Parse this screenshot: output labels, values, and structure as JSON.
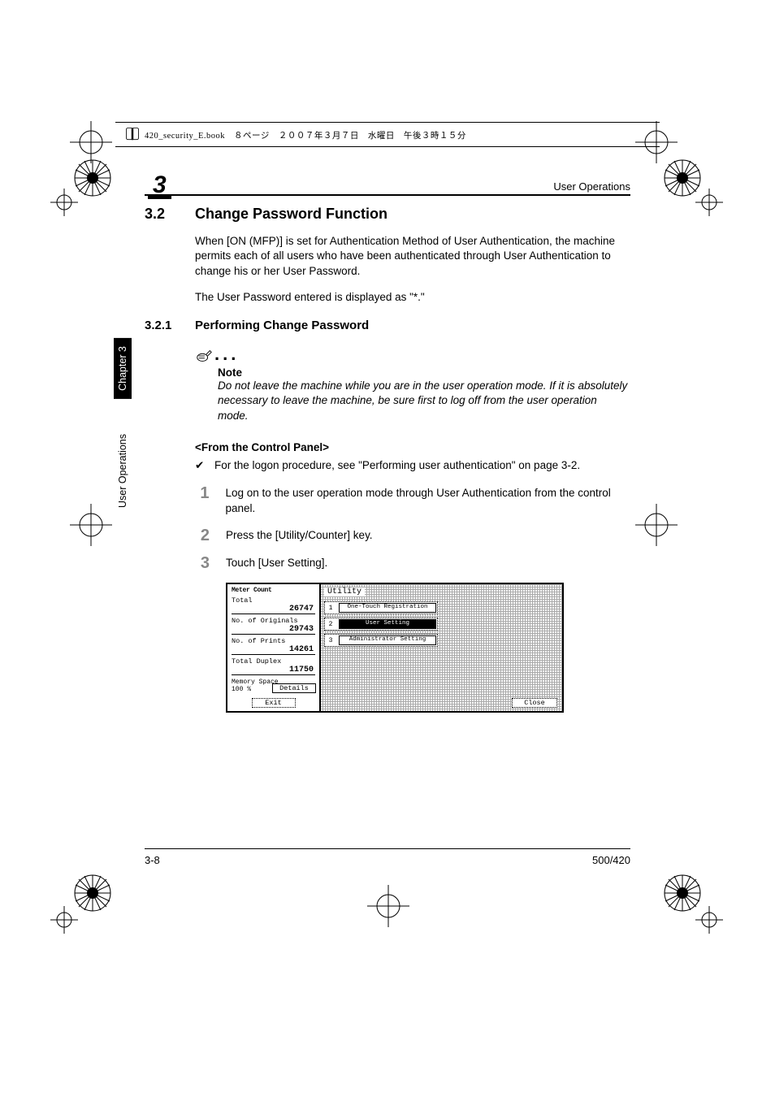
{
  "book_meta": "420_security_E.book　８ページ　２００７年３月７日　水曜日　午後３時１５分",
  "running_header": {
    "chapter_number": "3",
    "title": "User Operations"
  },
  "side_tabs": {
    "chapter": "Chapter 3",
    "section": "User Operations"
  },
  "heading_2": {
    "number": "3.2",
    "title": "Change Password Function"
  },
  "intro_paragraph": "When [ON (MFP)] is set for Authentication Method of User Authentication, the machine permits each of all users who have been authenticated through User Authentication to change his or her User Password.",
  "intro_paragraph2": "The User Password entered is displayed as \"*.\"",
  "heading_3": {
    "number": "3.2.1",
    "title": "Performing Change Password"
  },
  "note": {
    "label": "Note",
    "body": "Do not leave the machine while you are in the user operation mode. If it is absolutely necessary to leave the machine, be sure first to log off from the user operation mode."
  },
  "subhead": "<From the Control Panel>",
  "check_item_1": "For the logon procedure, see \"Performing user authentication\" on page 3-2.",
  "steps": [
    "Log on to the user operation mode through User Authentication from the control panel.",
    "Press the [Utility/Counter] key.",
    "Touch [User Setting]."
  ],
  "screenshot": {
    "meter_title": "Meter\nCount",
    "rows": [
      {
        "label": "Total",
        "value": "26747"
      },
      {
        "label": "No. of Originals",
        "value": "29743"
      },
      {
        "label": "No. of Prints",
        "value": "14261"
      },
      {
        "label": "Total Duplex",
        "value": "11750"
      }
    ],
    "memory_label": "Memory\nSpace",
    "memory_value": "100 %",
    "details_btn": "Details",
    "exit_btn": "Exit",
    "utility_title": "Utility",
    "menu": [
      {
        "idx": "1",
        "label": "One-Touch\nRegistration",
        "selected": false
      },
      {
        "idx": "2",
        "label": "User Setting",
        "selected": true
      },
      {
        "idx": "3",
        "label": "Administrator\nSetting",
        "selected": false
      }
    ],
    "close_btn": "Close"
  },
  "footer": {
    "page": "3-8",
    "model": "500/420"
  }
}
